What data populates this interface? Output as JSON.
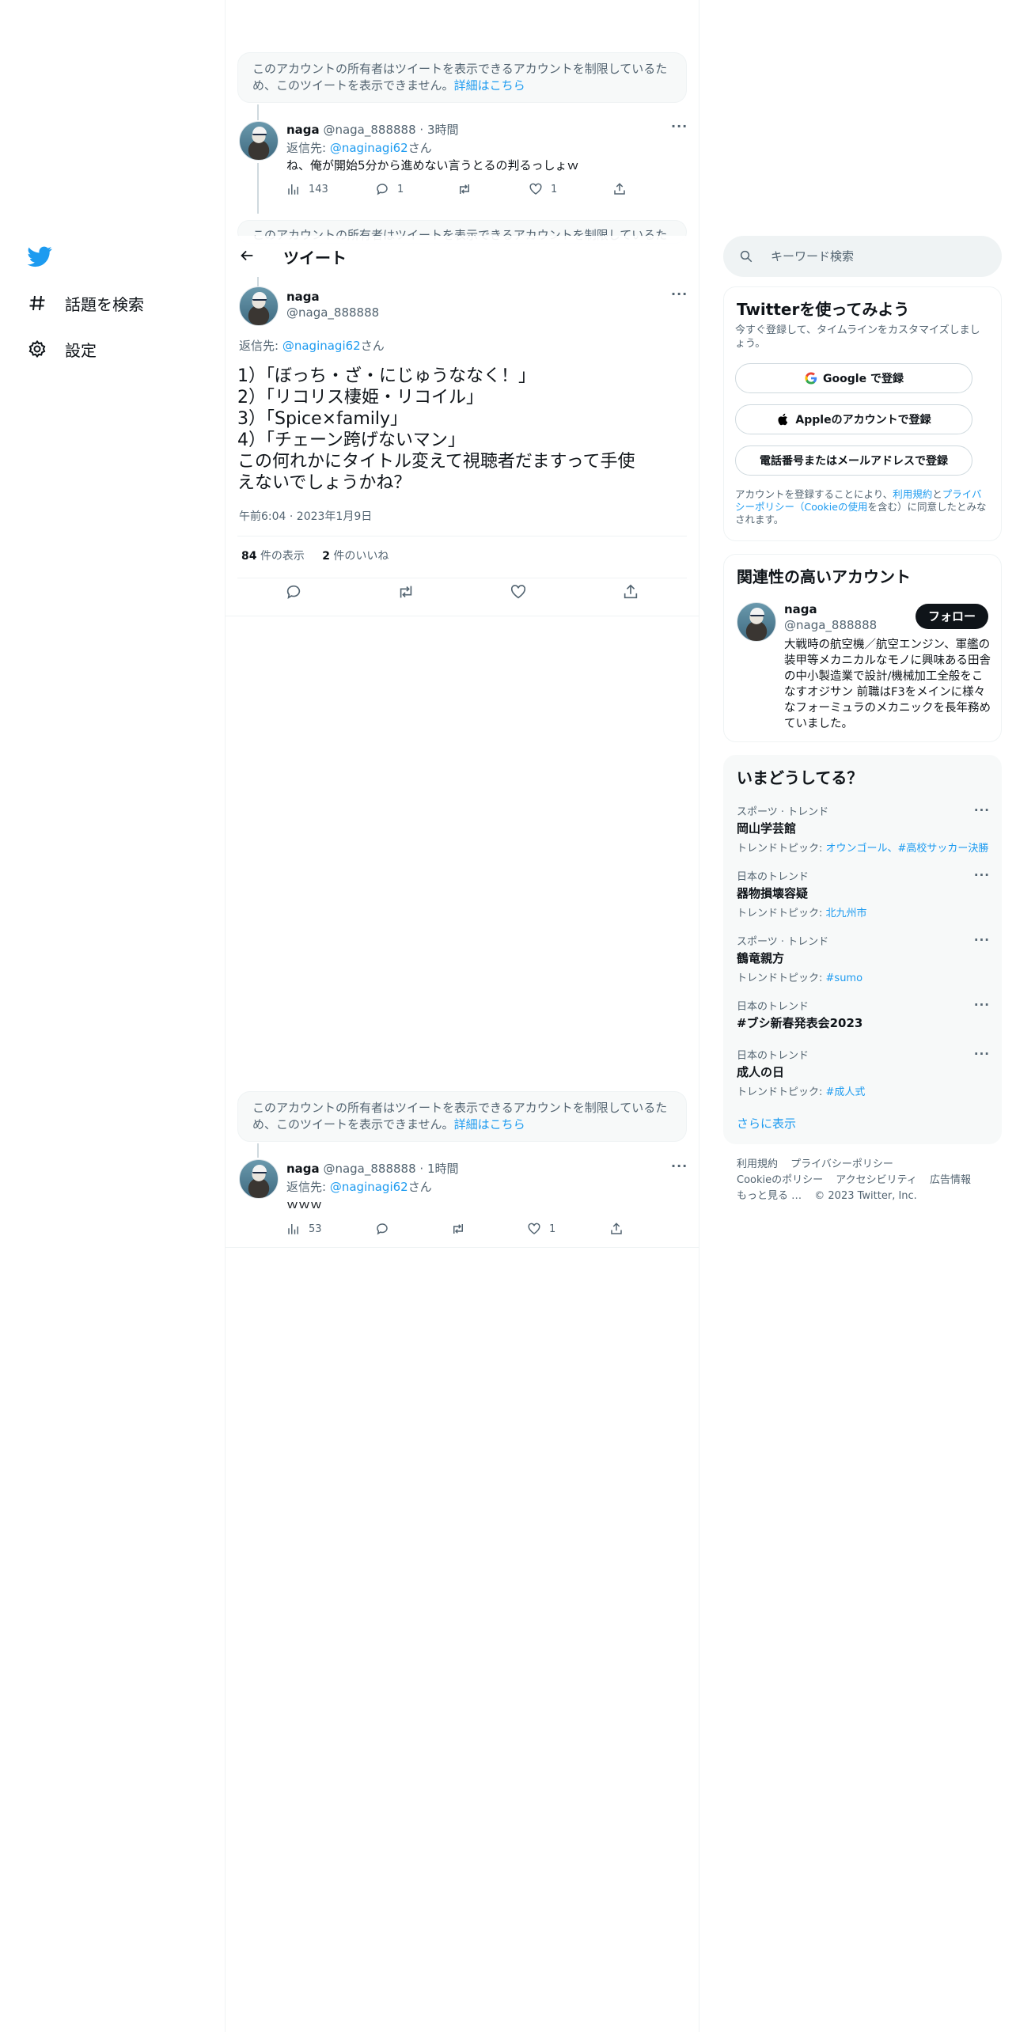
{
  "nav": {
    "items": [
      {
        "label": "話題を検索"
      },
      {
        "label": "設定"
      }
    ]
  },
  "header": {
    "title": "ツイート"
  },
  "notice": {
    "text": "このアカウントの所有者はツイートを表示できるアカウントを制限しているため、このツイートを表示できません。",
    "more": "詳細はこちら",
    "partial": "このアカウントの所有者はツイートを表示できるアカウントを制限しているた"
  },
  "tweet_top": {
    "name": "naga",
    "handle": "@naga_888888",
    "time": "3時間",
    "reply_prefix": "返信先:",
    "reply_to": "@naginagi62",
    "reply_suffix": "さん",
    "text": "ね、俺が開始5分から進めない言うとるの判るっしょｗ",
    "views": "143",
    "replies": "1",
    "retweets": "",
    "likes": "1"
  },
  "main_tweet": {
    "name": "naga",
    "handle": "@naga_888888",
    "reply_prefix": "返信先:",
    "reply_to": "@naginagi62",
    "reply_suffix": "さん",
    "lines": [
      "1）「ぼっち・ざ・にじゅうななく！」",
      "2）「リコリス棲姫・リコイル」",
      "3）「Spice×family」",
      "4）「チェーン跨げないマン」",
      "この何れかにタイトル変えて視聴者だますって手使",
      "えないでしょうかね？"
    ],
    "timestamp": "午前6:04 · 2023年1月9日",
    "views_count": "84",
    "views_label": "件の表示",
    "likes_count": "2",
    "likes_label": "件のいいね"
  },
  "tweet_bottom": {
    "name": "naga",
    "handle": "@naga_888888",
    "time": "1時間",
    "reply_prefix": "返信先:",
    "reply_to": "@naginagi62",
    "reply_suffix": "さん",
    "text": "ｗｗｗ",
    "views": "53",
    "replies": "",
    "retweets": "",
    "likes": "1"
  },
  "search": {
    "placeholder": "キーワード検索"
  },
  "signup": {
    "title": "Twitterを使ってみよう",
    "subtitle": "今すぐ登録して、タイムラインをカスタマイズしましょう。",
    "google": "Google で登録",
    "apple": "Appleのアカウントで登録",
    "phone": "電話番号またはメールアドレスで登録",
    "legal_1": "アカウントを登録することにより、",
    "legal_terms": "利用規約",
    "legal_and": "と",
    "legal_privacy": "プライバシーポリシー",
    "legal_cookie": "（Cookieの使用",
    "legal_2": "を含む）に同意したとみなされます。"
  },
  "relevant": {
    "title": "関連性の高いアカウント",
    "name": "naga",
    "handle": "@naga_888888",
    "follow": "フォロー",
    "bio": "大戦時の航空機／航空エンジン、軍艦の装甲等メカニカルなモノに興味ある田舎の中小製造業で設計/機械加工全般をこなすオジサン 前職はF3をメインに様々なフォーミュラのメカニックを長年務めていました。"
  },
  "trends": {
    "title": "いまどうしてる？",
    "items": [
      {
        "category": "スポーツ · トレンド",
        "name": "岡山学芸館",
        "topic_label": "トレンドトピック:",
        "topic": "オウンゴール、#高校サッカー決勝"
      },
      {
        "category": "日本のトレンド",
        "name": "器物損壊容疑",
        "topic_label": "トレンドトピック:",
        "topic": "北九州市"
      },
      {
        "category": "スポーツ · トレンド",
        "name": "鶴竜親方",
        "topic_label": "トレンドトピック:",
        "topic": "#sumo"
      },
      {
        "category": "日本のトレンド",
        "name": "#ブシ新春発表会2023",
        "topic_label": "",
        "topic": ""
      },
      {
        "category": "日本のトレンド",
        "name": "成人の日",
        "topic_label": "トレンドトピック:",
        "topic": "#成人式"
      }
    ],
    "show_more": "さらに表示"
  },
  "footer": {
    "links": [
      "利用規約",
      "プライバシーポリシー",
      "Cookieのポリシー",
      "アクセシビリティ",
      "広告情報",
      "もっと見る …"
    ],
    "copyright": "© 2023 Twitter, Inc."
  },
  "colors": {
    "accent": "#1d9bf0",
    "text": "#0f1419",
    "muted": "#536471",
    "border": "#eff3f4"
  }
}
